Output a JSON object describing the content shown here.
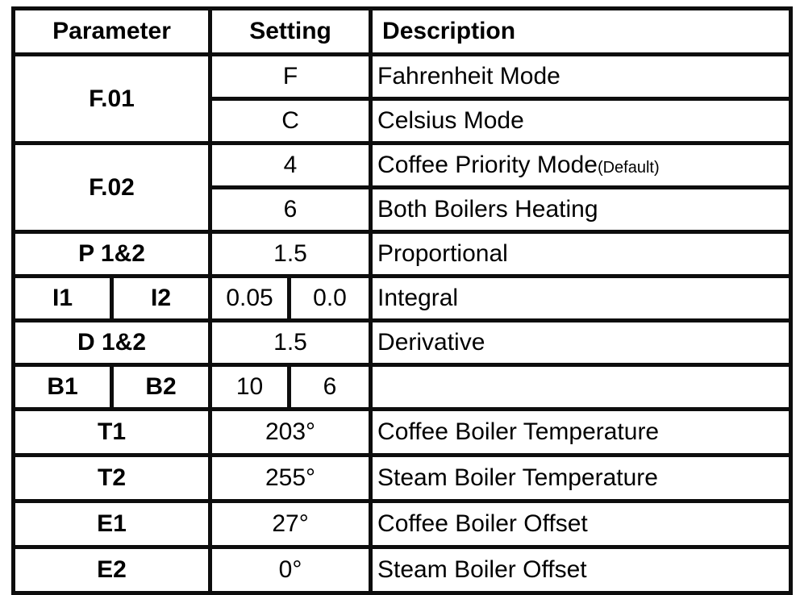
{
  "table": {
    "headers": {
      "parameter": "Parameter",
      "setting": "Setting",
      "description": "Description"
    },
    "colors": {
      "header_background": "#938a5a",
      "row_tan_background": "#c4bb97",
      "row_white_background": "#ffffff",
      "border": "#0d0d0d",
      "highlight_edge": "#b85c54"
    },
    "rows": [
      {
        "parameter": "F.01",
        "setting": "F",
        "description": "Fahrenheit Mode",
        "shade": "white"
      },
      {
        "parameter": "",
        "setting": "C",
        "description": "Celsius Mode",
        "shade": "white"
      },
      {
        "parameter": "F.02",
        "setting": "4",
        "description": "Coffee Priority Mode",
        "description_note": "(Default)",
        "shade": "tan"
      },
      {
        "parameter": "",
        "setting": "6",
        "description": "Both Boilers Heating",
        "shade": "tan"
      },
      {
        "parameter": "P 1&2",
        "setting": "1.5",
        "description": "Proportional",
        "shade": "white"
      },
      {
        "parameter_a": "I1",
        "parameter_b": "I2",
        "setting_a": "0.05",
        "setting_b": "0.0",
        "description": "Integral",
        "shade": "tan"
      },
      {
        "parameter": "D 1&2",
        "setting": "1.5",
        "description": "Derivative",
        "shade": "white"
      },
      {
        "parameter_a": "B1",
        "parameter_b": "B2",
        "setting_a": "10",
        "setting_b": "6",
        "description": "",
        "shade": "tan"
      },
      {
        "parameter": "T1",
        "setting": "203°",
        "description": "Coffee Boiler Temperature",
        "shade": "white",
        "highlighted": true
      },
      {
        "parameter": "T2",
        "setting": "255°",
        "description": "Steam Boiler Temperature",
        "shade": "tan"
      },
      {
        "parameter": "E1",
        "setting": "27°",
        "description": "Coffee Boiler Offset",
        "shade": "white",
        "highlighted": true
      },
      {
        "parameter": "E2",
        "setting": "0°",
        "description": "Steam Boiler Offset",
        "shade": "tan"
      }
    ]
  }
}
